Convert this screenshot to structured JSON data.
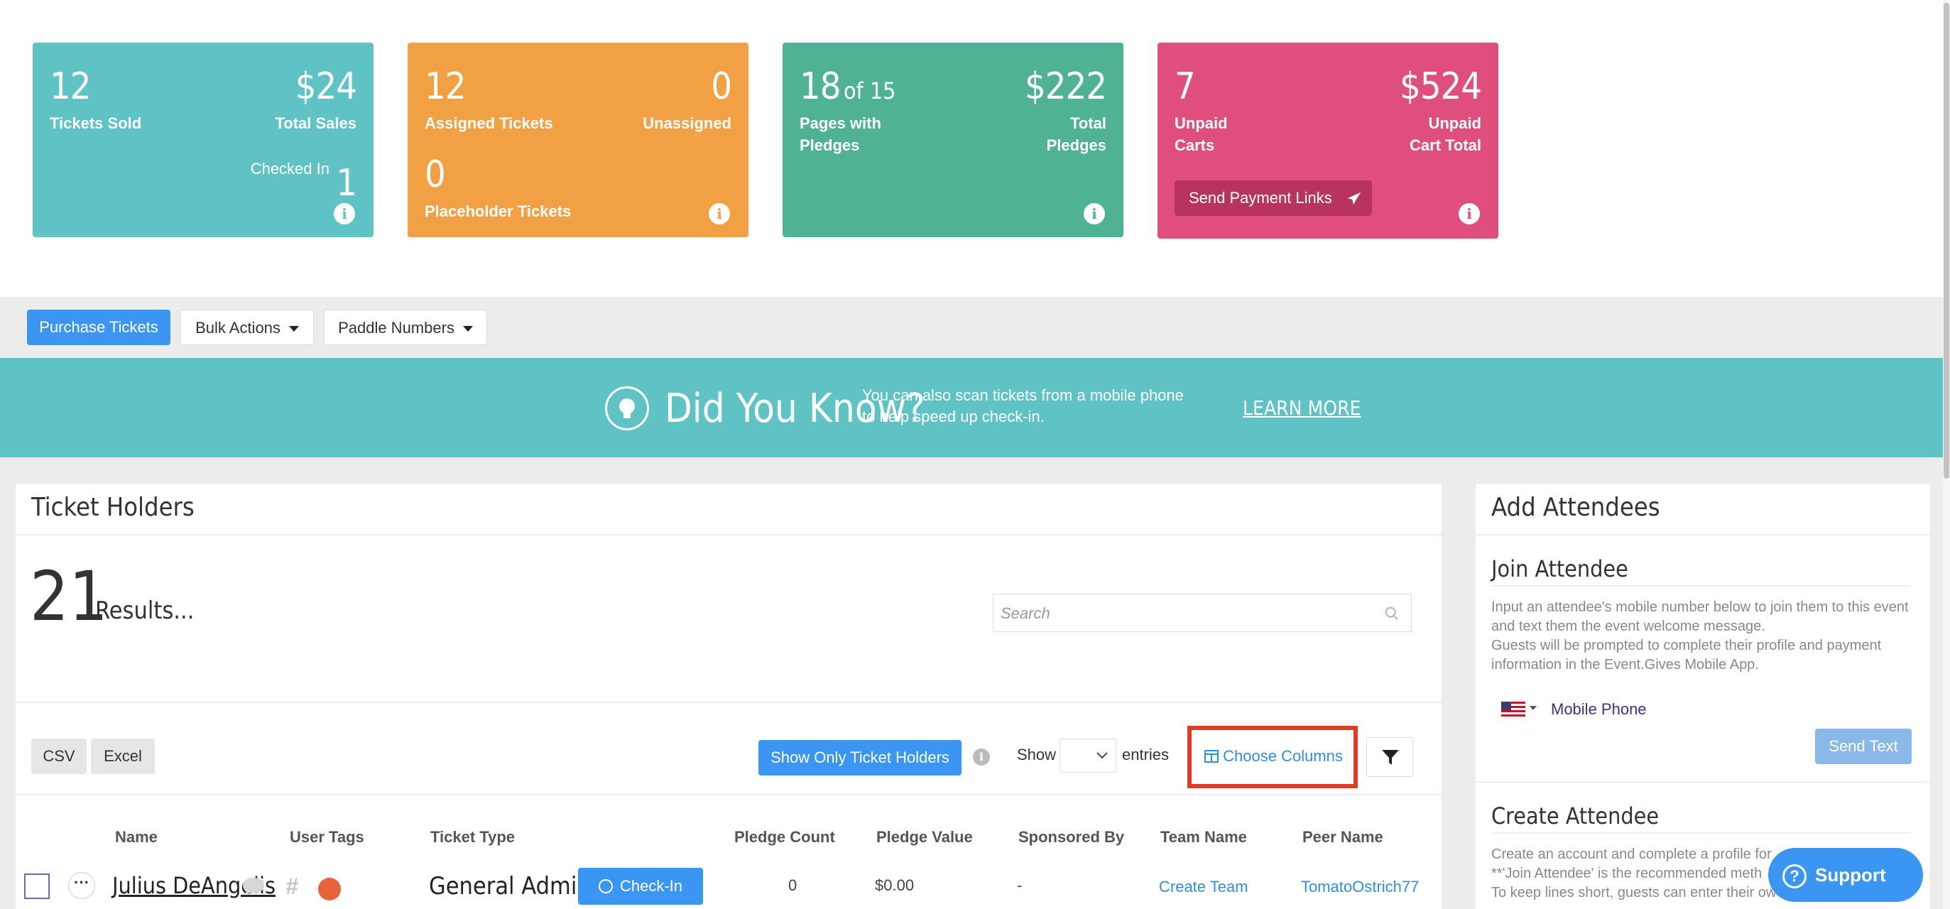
{
  "colors": {
    "teal": "#5fc2c5",
    "orange": "#f2a044",
    "green": "#4fb195",
    "pink": "#df4e7d",
    "blue": "#3b95f2",
    "highlight_red": "#e23b23"
  },
  "cards": {
    "sold": {
      "value": "12",
      "label": "Tickets Sold",
      "sales_value": "$24",
      "sales_label": "Total Sales",
      "checked_label": "Checked In",
      "checked_value": "1"
    },
    "assigned": {
      "value": "12",
      "label": "Assigned Tickets",
      "unassigned_value": "0",
      "unassigned_label": "Unassigned",
      "placeholder_value": "0",
      "placeholder_label": "Placeholder Tickets"
    },
    "pledges": {
      "pages_value": "18",
      "pages_of": "of 15",
      "pages_label": "Pages with Pledges",
      "total_value": "$222",
      "total_label": "Total Pledges"
    },
    "unpaid": {
      "carts_value": "7",
      "carts_label": "Unpaid Carts",
      "total_value": "$524",
      "total_label": "Unpaid Cart Total",
      "send_button": "Send Payment Links"
    }
  },
  "actions": {
    "purchase": "Purchase Tickets",
    "bulk": "Bulk Actions",
    "paddle": "Paddle Numbers"
  },
  "banner": {
    "title": "Did You Know?",
    "text": "You can also scan tickets from a mobile phone to help speed up check-in.",
    "link": "LEARN MORE"
  },
  "ticket_holders": {
    "title": "Ticket Holders",
    "count": "21",
    "results_label": "Results...",
    "search_placeholder": "Search",
    "csv": "CSV",
    "excel": "Excel",
    "show_only": "Show Only Ticket Holders",
    "show_label": "Show",
    "entries_label": "entries",
    "choose_columns": "Choose Columns",
    "columns": [
      "Name",
      "User Tags",
      "Ticket Type",
      "Pledge Count",
      "Pledge Value",
      "Sponsored By",
      "Team Name",
      "Peer Name"
    ],
    "rows": [
      {
        "name": "Julius DeAngelis",
        "ticket_type": "General Admission",
        "checkin": "Check-In",
        "pledge_count": "0",
        "pledge_value": "$0.00",
        "sponsored_by": "-",
        "team_name": "Create Team",
        "peer_name": "TomatoOstrich77"
      }
    ]
  },
  "add_attendees": {
    "title": "Add Attendees",
    "join_title": "Join Attendee",
    "join_text_1": "Input an attendee's mobile number below to join them to this event and text them the event welcome message.",
    "join_text_2": "Guests will be prompted to complete their profile and payment information in the Event.Gives Mobile App.",
    "phone_placeholder": "Mobile Phone",
    "send_text": "Send Text",
    "create_title": "Create Attendee",
    "create_line_1": "Create an account and complete a profile for",
    "create_line_2": "**'Join Attendee' is the recommended meth",
    "create_line_3": "To keep lines short, guests can enter their ow"
  },
  "support": "Support"
}
